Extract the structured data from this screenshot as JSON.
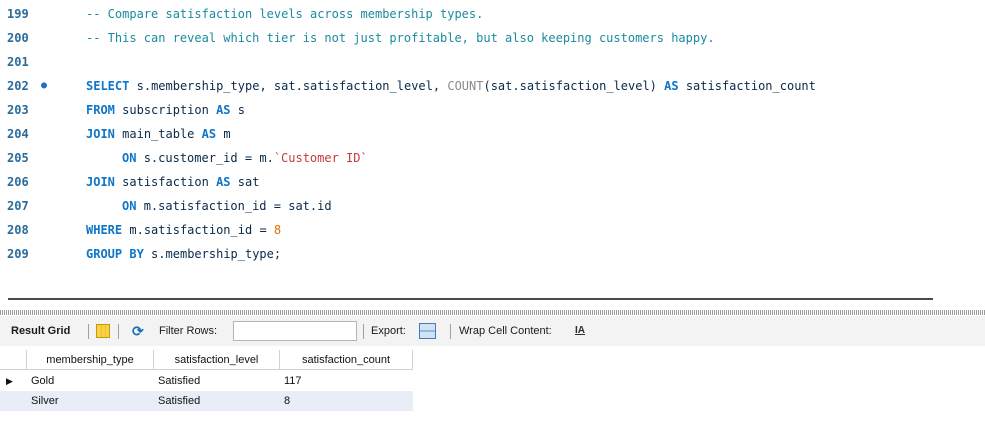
{
  "editor": {
    "lines": [
      {
        "num": "199",
        "marker": "",
        "text": "-- Compare satisfaction levels across membership types."
      },
      {
        "num": "200",
        "marker": "",
        "text": "-- This can reveal which tier is not just profitable, but also keeping customers happy."
      },
      {
        "num": "201",
        "marker": "",
        "text": ""
      },
      {
        "num": "202",
        "marker": "●",
        "text": "SELECT s.membership_type, sat.satisfaction_level, COUNT(sat.satisfaction_level) AS satisfaction_count"
      },
      {
        "num": "203",
        "marker": "",
        "text": "FROM subscription AS s"
      },
      {
        "num": "204",
        "marker": "",
        "text": "JOIN main_table AS m"
      },
      {
        "num": "205",
        "marker": "",
        "text": "ON s.customer_id = m.`Customer ID`"
      },
      {
        "num": "206",
        "marker": "",
        "text": "JOIN satisfaction AS sat"
      },
      {
        "num": "207",
        "marker": "",
        "text": "ON m.satisfaction_id = sat.id"
      },
      {
        "num": "208",
        "marker": "",
        "text": "WHERE m.satisfaction_id = 8"
      },
      {
        "num": "209",
        "marker": "",
        "text": "GROUP BY s.membership_type;"
      }
    ]
  },
  "toolbar": {
    "result_grid_label": "Result Grid",
    "filter_label": "Filter Rows:",
    "filter_value": "",
    "export_label": "Export:",
    "wrap_label": "Wrap Cell Content:",
    "wrap_icon_glyph": "IA",
    "icons": [
      "grid-view-icon",
      "refresh-icon",
      "export-icon",
      "wrap-cell-icon"
    ]
  },
  "grid": {
    "columns": [
      "membership_type",
      "satisfaction_level",
      "satisfaction_count"
    ],
    "rows": [
      {
        "membership_type": "Gold",
        "satisfaction_level": "Satisfied",
        "satisfaction_count": "117",
        "current": "▶"
      },
      {
        "membership_type": "Silver",
        "satisfaction_level": "Satisfied",
        "satisfaction_count": "8",
        "current": ""
      }
    ]
  },
  "colors": {
    "keyword": "#0d76c9",
    "comment": "#1a8aa0",
    "string": "#c43a3a",
    "number": "#e06a00",
    "line_number": "#2a6b9a",
    "row_alt": "#e8edf7"
  }
}
